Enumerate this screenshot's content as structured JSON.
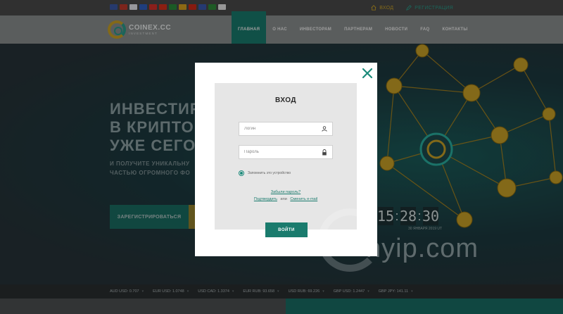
{
  "topbar": {
    "flags": [
      {
        "name": "us-flag",
        "color": "#3b5aa8"
      },
      {
        "name": "de-flag",
        "color": "#c0392b"
      },
      {
        "name": "ru-flag",
        "color": "#e8e8f0"
      },
      {
        "name": "fr-flag",
        "color": "#3060c0"
      },
      {
        "name": "tr-flag",
        "color": "#d4302a"
      },
      {
        "name": "vn-flag",
        "color": "#d8301c"
      },
      {
        "name": "pt-flag",
        "color": "#2a8a3a"
      },
      {
        "name": "es-flag",
        "color": "#d8a020"
      },
      {
        "name": "cn-flag",
        "color": "#d02a1a"
      },
      {
        "name": "cz-flag",
        "color": "#3a5ab0"
      },
      {
        "name": "sa-flag",
        "color": "#2e8a3a"
      },
      {
        "name": "pl-flag",
        "color": "#e8e8e8"
      }
    ],
    "login_label": "ВХОД",
    "register_label": "РЕГИСТРАЦИЯ"
  },
  "header": {
    "logo_name": "COINEX.CC",
    "logo_sub": "INVESTMENT",
    "nav": [
      "ГЛАВНАЯ",
      "О НАС",
      "ИНВЕСТОРАМ",
      "ПАРТНЕРАМ",
      "НОВОСТИ",
      "FAQ",
      "КОНТАКТЫ"
    ]
  },
  "hero": {
    "title_lines": [
      "ИНВЕСТИР",
      "В КРИПТО",
      "УЖЕ СЕГО"
    ],
    "sub_lines": [
      "И ПОЛУЧИТЕ УНИКАЛЬНУ",
      "ЧАСТЬЮ ОГРОМНОГО ФО"
    ],
    "register_button": "ЗАРЕГИСТРИРОВАТЬСЯ",
    "timer": {
      "hh": "15",
      "mm": "28",
      "ss": "30",
      "date": "30 ЯНВАРЯ 2019 UT"
    }
  },
  "ticker": [
    {
      "text": "AUD USD: 0.707"
    },
    {
      "text": "EUR USD: 1.0748"
    },
    {
      "text": "USD CAD: 1.3374"
    },
    {
      "text": "EUR RUB: 93.658"
    },
    {
      "text": "USD RUB: 69.226"
    },
    {
      "text": "GBP USD: 1.2447"
    },
    {
      "text": "GBP JPY: 141.11"
    }
  ],
  "modal": {
    "title": "ВХОД",
    "login_placeholder": "Логин",
    "password_placeholder": "Пароль",
    "remember_label": "Запомнить это устройство",
    "forgot_link": "Забыли пароль?",
    "confirm_link": "Подтвердить",
    "or_text": "или",
    "change_email_link": "Сменить e-mail",
    "submit_label": "ВОЙТИ"
  },
  "watermark": {
    "text": "hyip.com"
  },
  "colors": {
    "accent": "#1a7b6d",
    "gold": "#c9a227"
  }
}
